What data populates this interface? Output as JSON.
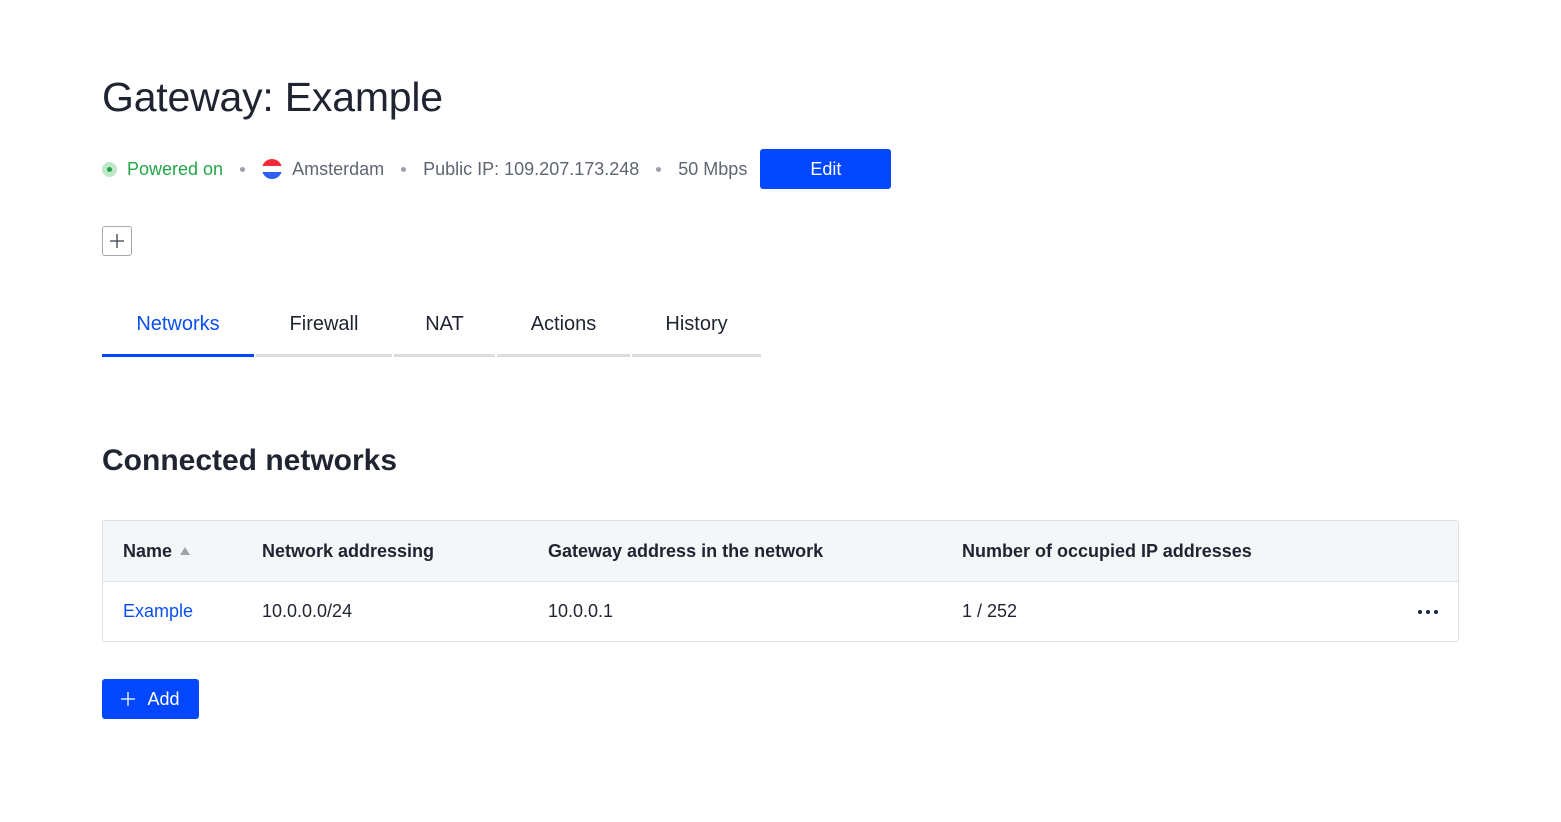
{
  "header": {
    "title": "Gateway: Example",
    "status": {
      "label": "Powered on",
      "color": "#22a748"
    },
    "location": {
      "label": "Amsterdam",
      "flag_icon": "netherlands-flag-icon"
    },
    "public_ip": "Public IP: 109.207.173.248",
    "bandwidth": "50 Mbps",
    "edit_label": "Edit"
  },
  "expand_button": {
    "icon": "plus-icon"
  },
  "tabs": [
    {
      "label": "Networks",
      "active": true
    },
    {
      "label": "Firewall",
      "active": false
    },
    {
      "label": "NAT",
      "active": false
    },
    {
      "label": "Actions",
      "active": false
    },
    {
      "label": "History",
      "active": false
    }
  ],
  "section": {
    "title": "Connected networks",
    "table": {
      "columns": [
        {
          "label": "Name",
          "sort": "ascending"
        },
        {
          "label": "Network addressing"
        },
        {
          "label": "Gateway address in the network"
        },
        {
          "label": "Number of occupied IP addresses"
        }
      ],
      "rows": [
        {
          "name": "Example",
          "addressing": "10.0.0.0/24",
          "gateway": "10.0.0.1",
          "occupied": "1 / 252",
          "menu_icon": "more-horizontal-icon"
        }
      ]
    },
    "add_label": "Add"
  },
  "colors": {
    "accent": "#0047ff",
    "link": "#0b4ff0",
    "status_green": "#22a748"
  }
}
